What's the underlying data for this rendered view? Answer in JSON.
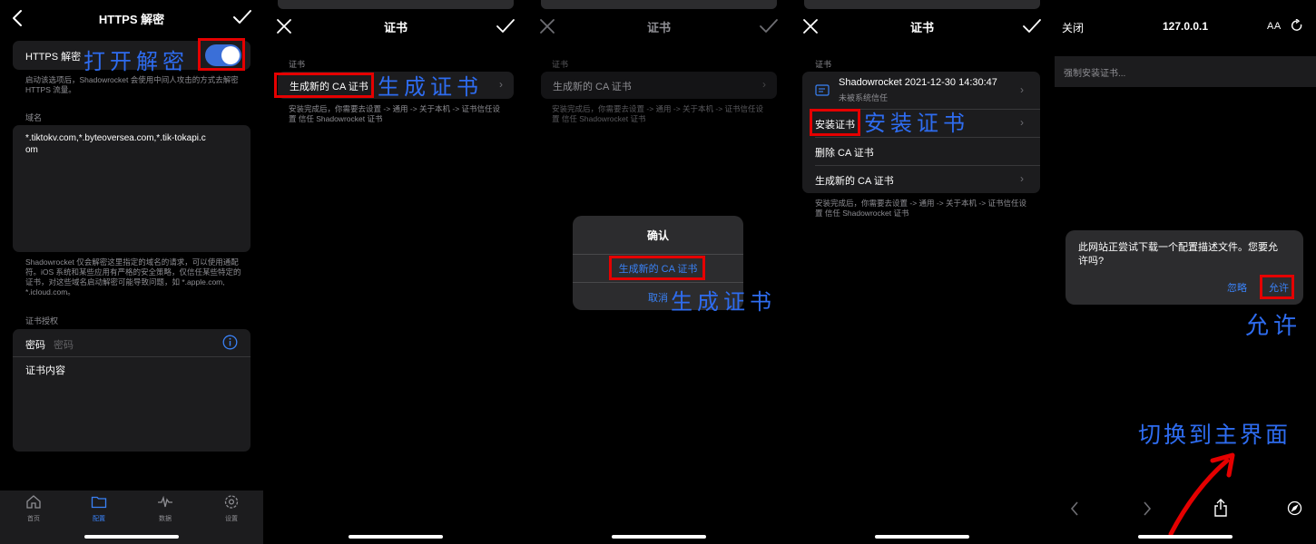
{
  "panel1": {
    "title": "HTTPS 解密",
    "https_label": "HTTPS 解密",
    "toggle_on": true,
    "annotation": "打开解密",
    "https_note": "启动该选项后，Shadowrocket 会使用中间人攻击的方式去解密 HTTPS 流量。",
    "domain_section": "域名",
    "domain_value": "*.tiktokv.com,*.byteoversea.com,*.tik-tokapi.com",
    "domain_note": "Shadowrocket 仅会解密这里指定的域名的请求，可以使用通配符。iOS 系统和某些应用有严格的安全策略，仅信任某些特定的证书，对这些域名启动解密可能导致问题，如 *.apple.com, *.icloud.com。",
    "cert_auth_section": "证书授权",
    "password_label": "密码",
    "password_placeholder": "密码",
    "cert_content_label": "证书内容",
    "tabbar": [
      {
        "label": "首页",
        "icon": "home-icon"
      },
      {
        "label": "配置",
        "icon": "folder-icon"
      },
      {
        "label": "数据",
        "icon": "pulse-icon"
      },
      {
        "label": "设置",
        "icon": "gear-icon"
      }
    ]
  },
  "panel2": {
    "title": "证书",
    "section": "证书",
    "generate_label": "生成新的 CA 证书",
    "annotation": "生成证书",
    "note": "安装完成后，你需要去设置 -> 通用 -> 关于本机 -> 证书信任设置 信任 Shadowrocket 证书"
  },
  "panel3": {
    "title": "证书",
    "section": "证书",
    "generate_label": "生成新的 CA 证书",
    "note": "安装完成后，你需要去设置 -> 通用 -> 关于本机 -> 证书信任设置 信任 Shadowrocket 证书",
    "alert_title": "确认",
    "alert_confirm": "生成新的 CA 证书",
    "alert_cancel": "取消",
    "annotation": "生成证书"
  },
  "panel4": {
    "title": "证书",
    "section": "证书",
    "cert_name": "Shadowrocket 2021-12-30 14:30:47",
    "cert_status": "未被系统信任",
    "install_label": "安装证书",
    "install_annotation": "安装证书",
    "delete_label": "删除 CA 证书",
    "generate_label": "生成新的 CA 证书",
    "note": "安装完成后，你需要去设置 -> 通用 -> 关于本机 -> 证书信任设置 信任 Shadowrocket 证书"
  },
  "panel5": {
    "close_label": "关闭",
    "address": "127.0.0.1",
    "text_size_label": "AA",
    "banner_text": "强制安装证书...",
    "dialog_text": "此网站正尝试下载一个配置描述文件。您要允许吗?",
    "ignore_label": "忽略",
    "allow_label": "允许",
    "allow_annotation": "允许",
    "switch_annotation": "切换到主界面"
  },
  "colors": {
    "accent": "#2e6cf0",
    "red_highlight": "#e50000",
    "ios_blue": "#3a82f7",
    "card": "#1c1c1e",
    "secondary_text": "#8e8e93"
  }
}
